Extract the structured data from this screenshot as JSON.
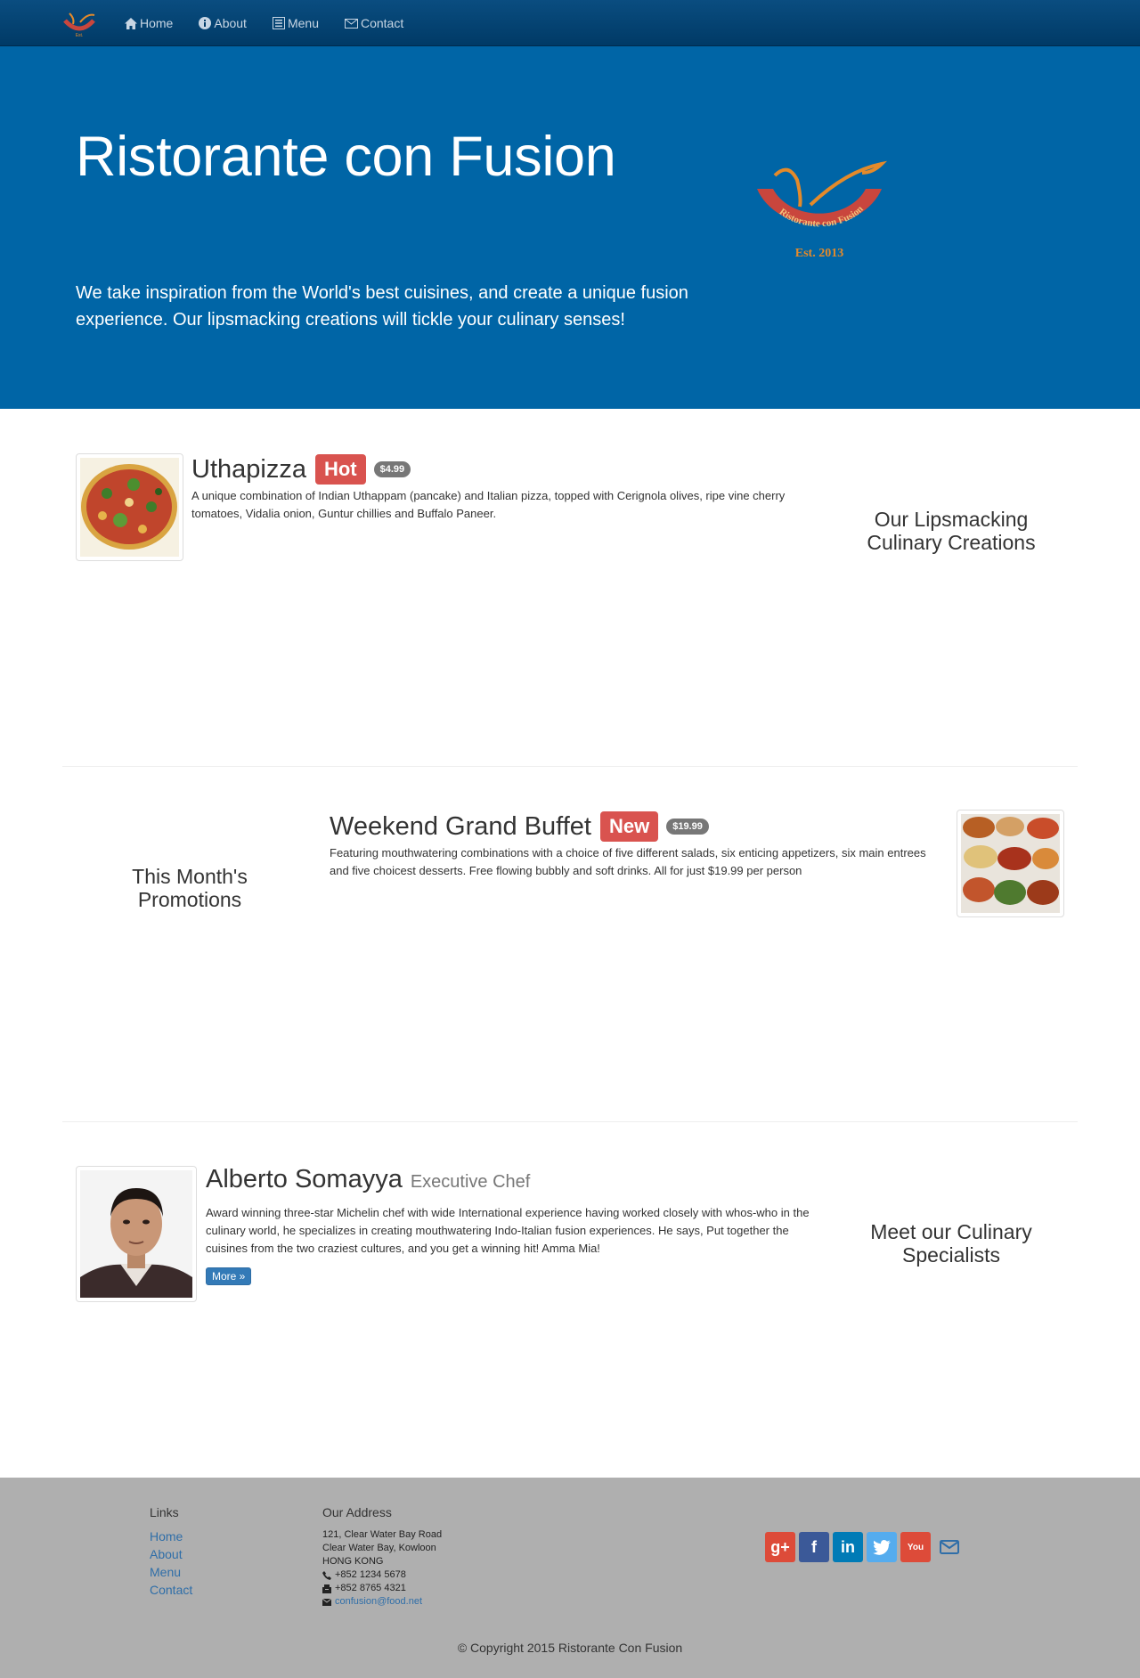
{
  "navbar": {
    "items": [
      {
        "label": "Home",
        "icon": "home-icon"
      },
      {
        "label": "About",
        "icon": "info-icon"
      },
      {
        "label": "Menu",
        "icon": "list-icon"
      },
      {
        "label": "Contact",
        "icon": "envelope-icon"
      }
    ]
  },
  "jumbotron": {
    "title": "Ristorante con Fusion",
    "subtitle": "We take inspiration from the World's best cuisines, and create a unique fusion experience. Our lipsmacking creations will tickle your culinary senses!",
    "logo_text": "Ristorante con Fusion",
    "logo_est": "Est. 2013"
  },
  "dish": {
    "name": "Uthapizza",
    "label": "Hot",
    "price": "$4.99",
    "description": "A unique combination of Indian Uthappam (pancake) and Italian pizza, topped with Cerignola olives, ripe vine cherry tomatoes, Vidalia onion, Guntur chillies and Buffalo Paneer.",
    "section_title": "Our Lipsmacking Culinary Creations"
  },
  "promotion": {
    "name": "Weekend Grand Buffet",
    "label": "New",
    "price": "$19.99",
    "description": "Featuring mouthwatering combinations with a choice of five different salads, six enticing appetizers, six main entrees and five choicest desserts. Free flowing bubbly and soft drinks. All for just $19.99 per person",
    "section_title": "This Month's Promotions"
  },
  "chef": {
    "name": "Alberto Somayya",
    "designation": "Executive Chef",
    "description": "Award winning three-star Michelin chef with wide International experience having worked closely with whos-who in the culinary world, he specializes in creating mouthwatering Indo-Italian fusion experiences. He says, Put together the cuisines from the two craziest cultures, and you get a winning hit! Amma Mia!",
    "more_label": "More »",
    "section_title": "Meet our Culinary Specialists"
  },
  "footer": {
    "links_heading": "Links",
    "links": [
      "Home",
      "About",
      "Menu",
      "Contact"
    ],
    "address_heading": "Our Address",
    "address_lines": [
      "121, Clear Water Bay Road",
      "Clear Water Bay, Kowloon",
      "HONG KONG"
    ],
    "phone": "+852 1234 5678",
    "fax": "+852 8765 4321",
    "email": "confusion@food.net",
    "social": [
      {
        "name": "google-plus",
        "color": "#dd4b39",
        "glyph": "g+"
      },
      {
        "name": "facebook",
        "color": "#3b5998",
        "glyph": "f"
      },
      {
        "name": "linkedin",
        "color": "#007bb6",
        "glyph": "in"
      },
      {
        "name": "twitter",
        "color": "#55acee",
        "glyph": "t"
      },
      {
        "name": "youtube",
        "color": "#bb0000",
        "glyph": "You"
      }
    ],
    "copyright": "© Copyright 2015 Ristorante Con Fusion"
  },
  "colors": {
    "navbar": "#003a66",
    "jumbotron": "#0065a6",
    "label_red": "#d9534f",
    "badge_gray": "#777777",
    "footer": "#afafaf",
    "link": "#2f6ea8",
    "button": "#337ab7"
  }
}
